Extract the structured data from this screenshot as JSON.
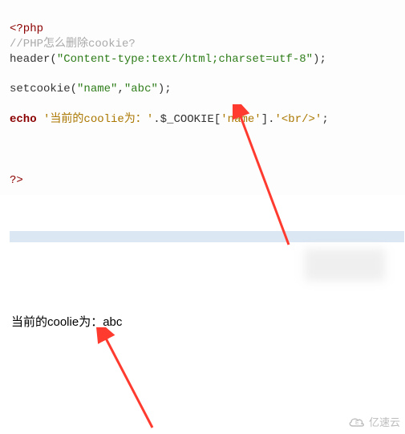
{
  "code": {
    "open_tag": "<?php",
    "comment": "//PHP怎么删除cookie?",
    "header_fn": "header",
    "header_arg": "\"Content-type:text/html;charset=utf-8\"",
    "header_end": ");",
    "setcookie_fn": "setcookie",
    "setcookie_open": "(",
    "setcookie_arg1": "\"name\"",
    "setcookie_comma": ",",
    "setcookie_arg2": "\"abc\"",
    "setcookie_close": ");",
    "echo_kw": "echo",
    "echo_str1": "'当前的coolie为：'",
    "echo_dot1": ".",
    "echo_var": "$_COOKIE[",
    "echo_key": "'name'",
    "echo_var_close": "]",
    "echo_dot2": ".",
    "echo_str2": "'<br/>'",
    "echo_semi": ";",
    "close_tag": "?>"
  },
  "output_line": "当前的coolie为：abc",
  "watermark_text": "亿速云",
  "colors": {
    "highlight": "#dbe7f3",
    "arrow": "#ff3b30"
  }
}
